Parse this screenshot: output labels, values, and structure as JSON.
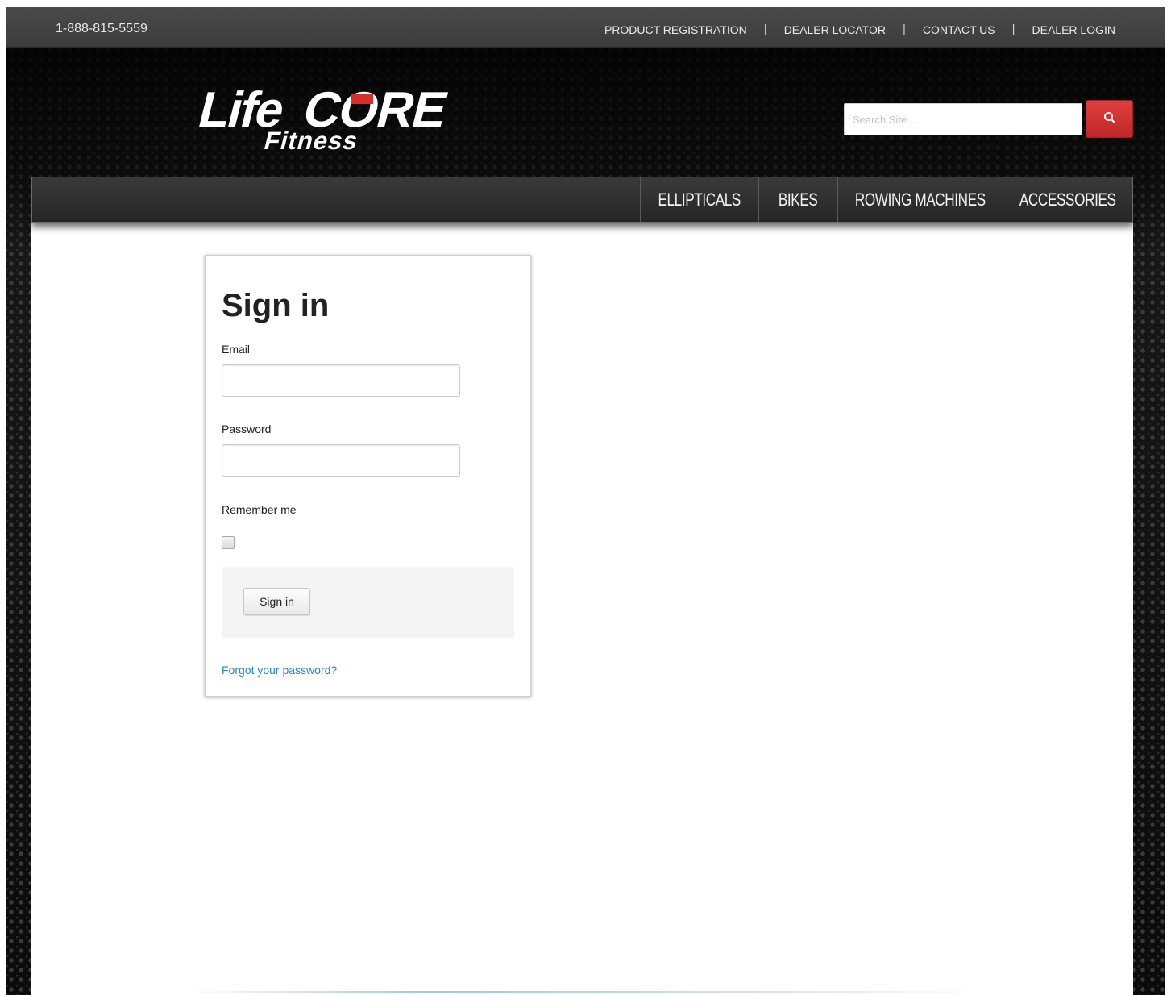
{
  "header": {
    "phone": "1-888-815-5559",
    "top_links": [
      "PRODUCT REGISTRATION",
      "DEALER LOCATOR",
      "CONTACT US",
      "DEALER LOGIN"
    ],
    "separator": "|"
  },
  "logo": {
    "brand_line1_part1": "Life",
    "brand_line1_part2": "CORE",
    "brand_line2": "Fitness"
  },
  "search": {
    "placeholder": "Search Site ..."
  },
  "nav": {
    "items": [
      "ELLIPTICALS",
      "BIKES",
      "ROWING MACHINES",
      "ACCESSORIES"
    ]
  },
  "signin": {
    "title": "Sign in",
    "email_label": "Email",
    "email_value": "",
    "password_label": "Password",
    "password_value": "",
    "remember_label": "Remember me",
    "submit_label": "Sign in",
    "forgot_label": "Forgot your password?"
  },
  "colors": {
    "accent_red": "#d2302f",
    "link_blue": "#2a86b8"
  }
}
